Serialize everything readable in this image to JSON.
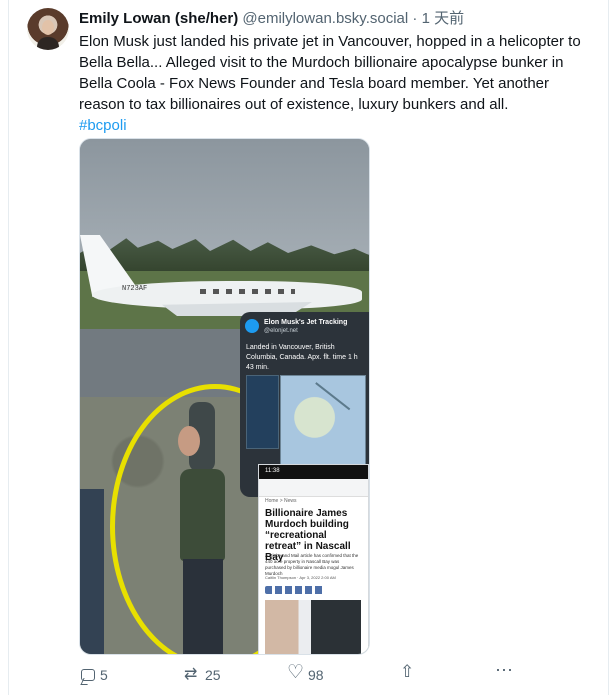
{
  "post": {
    "author": {
      "name": "Emily Lowan (she/her)",
      "handle": "@emilylowan.bsky.social",
      "separator": "·",
      "time": "1 天前"
    },
    "text": "Elon Musk just landed his private jet in Vancouver, hopped in a helicopter to Bella Bella... Alleged visit to the Murdoch billionaire apocalypse bunker in Bella Coola - Fox News Founder and Tesla board member. Yet another reason to tax billionaires out of existence, luxury bunkers and all.",
    "hashtag": "#bcpoli",
    "media": {
      "jet_registration": "N723AF",
      "tracker": {
        "title": "Elon Musk's Jet Tracking",
        "handle": "@elonjet.net",
        "text": "Landed in Vancouver, British Columbia, Canada. Apx. flt. time 1 h 43 min."
      },
      "article": {
        "status_time": "11:38",
        "breadcrumb": "Home > News",
        "title": "Billionaire James Murdoch building “recreational retreat” in Nascall Bay",
        "body": "A Globe and Mail article has confirmed that the 440 acre property in Nascall Bay was purchased by billionaire media mogul James Murdoch",
        "byline": "Caitlin Thompson · Apr 3, 2022 2:00 AM"
      }
    },
    "actions": {
      "replies": "5",
      "reposts": "25",
      "likes": "98"
    }
  },
  "colors": {
    "accent": "#1d9bf0",
    "muted": "#536471",
    "text": "#0f1419",
    "border": "#e6ecf0"
  }
}
